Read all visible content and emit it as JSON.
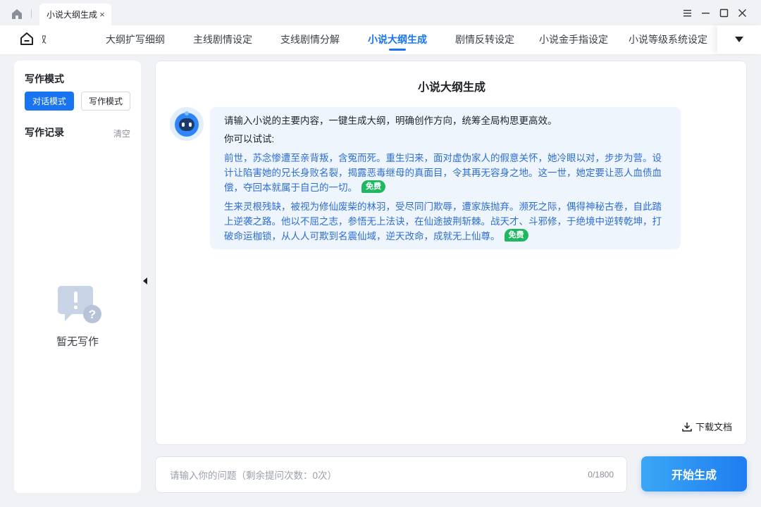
{
  "titlebar": {
    "tab_title": "小说大纲生成",
    "tab_close": "×",
    "home_icon": "home-icon",
    "controls": [
      "menu-icon",
      "minimize-icon",
      "maximize-icon",
      "close-icon"
    ]
  },
  "nav": {
    "home_icon": "home-outline-icon",
    "tabs": [
      {
        "label": "提取"
      },
      {
        "label": "大纲扩写细纲"
      },
      {
        "label": "主线剧情设定"
      },
      {
        "label": "支线剧情分解"
      },
      {
        "label": "小说大纲生成",
        "active": true
      },
      {
        "label": "剧情反转设定"
      },
      {
        "label": "小说金手指设定"
      },
      {
        "label": "小说等级系统设定"
      }
    ],
    "more_icon": "caret-down-icon"
  },
  "sidebar": {
    "mode_title": "写作模式",
    "mode_chat": "对话模式",
    "mode_write": "写作模式",
    "records_title": "写作记录",
    "clear": "清空",
    "empty_text": "暂无写作"
  },
  "main": {
    "title": "小说大纲生成",
    "intro": "请输入小说的主要内容，一键生成大纲，明确创作方向，统筹全局构思更高效。",
    "try_label": "你可以试试:",
    "examples": [
      {
        "text": "前世，苏念惨遭至亲背叛，含冤而死。重生归来，面对虚伪家人的假意关怀，她冷眼以对，步步为营。设计让陷害她的兄长身败名裂，揭露恶毒继母的真面目，令其再无容身之地。这一世，她定要让恶人血债血偿，夺回本就属于自己的一切。",
        "badge": "免费"
      },
      {
        "text": "生来灵根残缺，被视为修仙废柴的林羽，受尽同门欺辱，遭家族抛弃。濒死之际，偶得神秘古卷，自此踏上逆袭之路。他以不屈之志，参悟无上法诀，在仙途披荆斩棘。战天才、斗邪修，于绝境中逆转乾坤，打破命运枷锁，从人人可欺到名震仙域，逆天改命，成就无上仙尊。",
        "badge": "免费"
      }
    ],
    "download": "下载文档"
  },
  "input": {
    "placeholder": "请输入你的问题（剩余提问次数：0次）",
    "value": "",
    "counter": "0/1800"
  },
  "generate_button": "开始生成",
  "colors": {
    "accent": "#1874f0",
    "bubble_bg": "#eef5fd",
    "example_text": "#2e6ed3",
    "badge_green": "#1fb860"
  }
}
